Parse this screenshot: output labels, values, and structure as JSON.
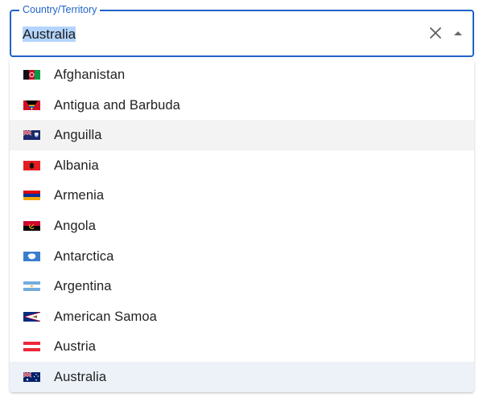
{
  "field": {
    "label": "Country/Territory",
    "value": "Australia",
    "accent_color": "#1f63c7"
  },
  "icons": {
    "clear": "close-icon",
    "popup": "arrow-drop-up-icon"
  },
  "options": [
    {
      "label": "Afghanistan",
      "flag": "flag-af-icon",
      "state": "normal"
    },
    {
      "label": "Antigua and Barbuda",
      "flag": "flag-ag-icon",
      "state": "normal"
    },
    {
      "label": "Anguilla",
      "flag": "flag-ai-icon",
      "state": "hover"
    },
    {
      "label": "Albania",
      "flag": "flag-al-icon",
      "state": "normal"
    },
    {
      "label": "Armenia",
      "flag": "flag-am-icon",
      "state": "normal"
    },
    {
      "label": "Angola",
      "flag": "flag-ao-icon",
      "state": "normal"
    },
    {
      "label": "Antarctica",
      "flag": "flag-aq-icon",
      "state": "normal"
    },
    {
      "label": "Argentina",
      "flag": "flag-ar-icon",
      "state": "normal"
    },
    {
      "label": "American Samoa",
      "flag": "flag-as-icon",
      "state": "normal"
    },
    {
      "label": "Austria",
      "flag": "flag-at-icon",
      "state": "normal"
    },
    {
      "label": "Australia",
      "flag": "flag-au-icon",
      "state": "selected"
    }
  ]
}
